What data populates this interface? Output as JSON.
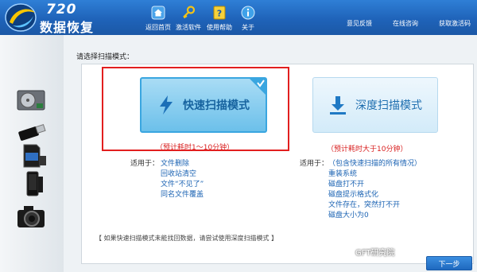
{
  "app": {
    "logo_number": "720",
    "logo_name": "数据恢复"
  },
  "toolbar": [
    {
      "label": "返回首页",
      "icon": "home-icon"
    },
    {
      "label": "激活软件",
      "icon": "key-icon"
    },
    {
      "label": "使用帮助",
      "icon": "help-icon"
    },
    {
      "label": "关于",
      "icon": "info-icon"
    }
  ],
  "top_links": [
    "意见反馈",
    "在线咨询",
    "获取激活码"
  ],
  "sidebar_devices": [
    "hard-drive-icon",
    "usb-drive-icon",
    "sd-card-icon",
    "phone-icon",
    "camera-icon"
  ],
  "main": {
    "prompt": "请选择扫描模式：",
    "quick": {
      "label": "快速扫描模式",
      "time": "（预计耗时1～10分钟）",
      "selected": true
    },
    "deep": {
      "label": "深度扫描模式",
      "time": "（预计耗时大于10分钟）"
    },
    "quick_usage": {
      "label": "适用于：",
      "items": [
        "文件删除",
        "回收站清空",
        "文件“不见了”",
        "同名文件覆盖"
      ]
    },
    "deep_usage": {
      "label": "适用于：",
      "items": [
        "（包含快速扫描的所有情况）",
        "重装系统",
        "磁盘打不开",
        "磁盘提示格式化",
        "文件存在，突然打不开",
        "磁盘大小为0"
      ]
    },
    "note": "【 如果快速扫描模式未能找回数据，请尝试使用深度扫描模式 】"
  },
  "watermark": "GFT研究院",
  "next_button": "下一步",
  "colors": {
    "header": "#1f63b9",
    "highlight": "#e21f1f",
    "accent": "#1b63b3",
    "time": "#d81e1e"
  }
}
